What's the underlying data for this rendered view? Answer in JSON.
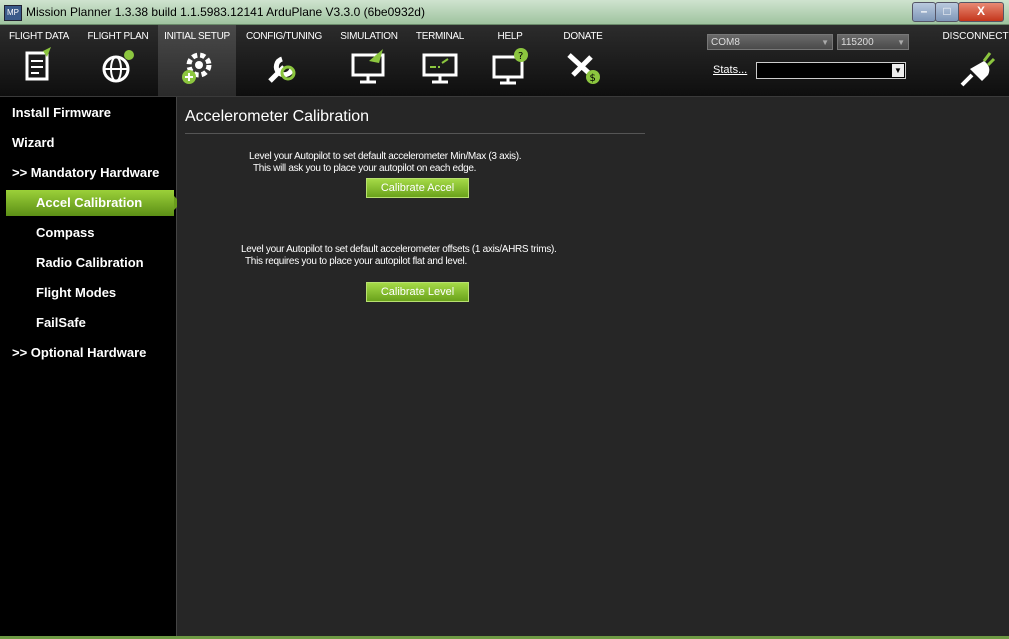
{
  "window": {
    "title": "Mission Planner 1.3.38 build 1.1.5983.12141 ArduPlane V3.3.0 (6be0932d)",
    "min_glyph": "–",
    "max_glyph": "□",
    "close_glyph": "X"
  },
  "menu": {
    "items": [
      {
        "label": "FLIGHT DATA",
        "icon": "flight-data-icon"
      },
      {
        "label": "FLIGHT PLAN",
        "icon": "flight-plan-icon"
      },
      {
        "label": "INITIAL SETUP",
        "icon": "initial-setup-icon"
      },
      {
        "label": "CONFIG/TUNING",
        "icon": "config-tuning-icon"
      },
      {
        "label": "SIMULATION",
        "icon": "simulation-icon"
      },
      {
        "label": "TERMINAL",
        "icon": "terminal-icon"
      },
      {
        "label": "HELP",
        "icon": "help-icon"
      },
      {
        "label": "DONATE",
        "icon": "donate-icon"
      }
    ],
    "active_index": 2
  },
  "connection": {
    "port": "COM8",
    "baud": "115200",
    "stats_label": "Stats...",
    "disconnect_label": "DISCONNECT"
  },
  "sidebar": {
    "items": [
      {
        "label": "Install Firmware"
      },
      {
        "label": "Wizard"
      },
      {
        "label": ">> Mandatory Hardware"
      },
      {
        "label": "Accel Calibration"
      },
      {
        "label": "Compass"
      },
      {
        "label": "Radio Calibration"
      },
      {
        "label": "Flight Modes"
      },
      {
        "label": "FailSafe"
      },
      {
        "label": ">> Optional Hardware"
      }
    ],
    "active_index": 3
  },
  "main": {
    "title": "Accelerometer Calibration",
    "accel_text_1": "Level your Autopilot to set default accelerometer Min/Max (3 axis).",
    "accel_text_2": "This will ask you to place your autopilot on each edge.",
    "accel_button": "Calibrate Accel",
    "level_text_1": "Level your Autopilot to set default accelerometer offsets (1 axis/AHRS trims).",
    "level_text_2": "This requires you to place your autopilot flat and level.",
    "level_button": "Calibrate Level"
  },
  "colors": {
    "accent_green": "#8cc63f",
    "background": "#262626",
    "sidebar_bg": "#000000"
  }
}
